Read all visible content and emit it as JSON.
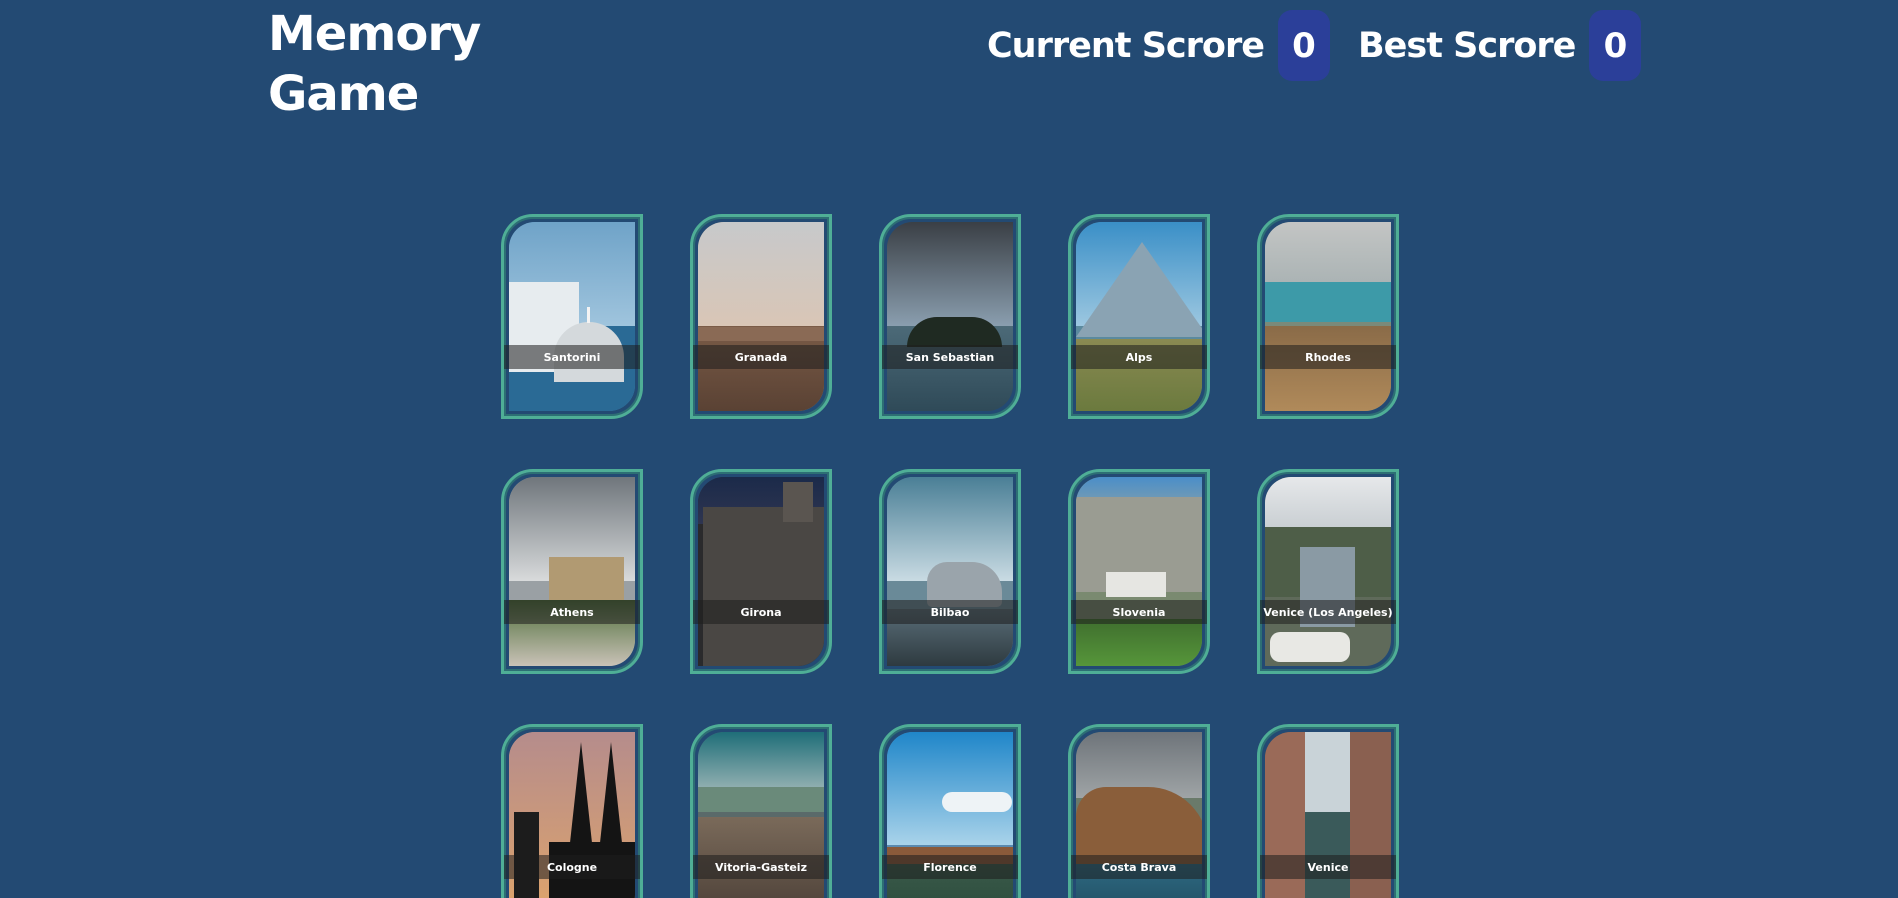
{
  "header": {
    "title": "Memory Game",
    "current_score_label": "Current Scrore",
    "current_score_value": "0",
    "best_score_label": "Best Scrore",
    "best_score_value": "0"
  },
  "colors": {
    "background": "#234a73",
    "score_box": "#2b3f99",
    "card_border": "#4fae96"
  },
  "cards": [
    {
      "label": "Santorini"
    },
    {
      "label": "Granada"
    },
    {
      "label": "San Sebastian"
    },
    {
      "label": "Alps"
    },
    {
      "label": "Rhodes"
    },
    {
      "label": "Athens"
    },
    {
      "label": "Girona"
    },
    {
      "label": "Bilbao"
    },
    {
      "label": "Slovenia"
    },
    {
      "label": "Venice (Los Angeles)"
    },
    {
      "label": "Cologne"
    },
    {
      "label": "Vitoria-Gasteiz"
    },
    {
      "label": "Florence"
    },
    {
      "label": "Costa Brava"
    },
    {
      "label": "Venice"
    }
  ]
}
